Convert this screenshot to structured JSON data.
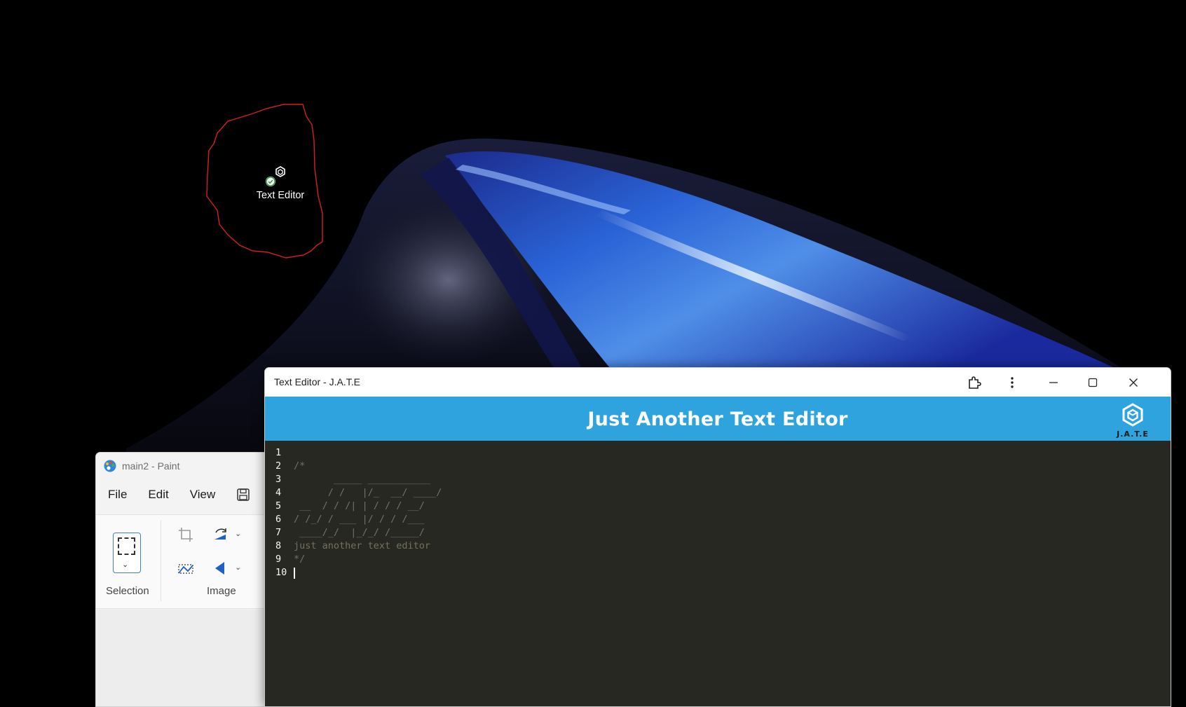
{
  "desktop": {
    "shortcut": {
      "label": "Text Editor",
      "icon": "jate-app-icon",
      "status_icon": "synced-check-icon"
    }
  },
  "paint": {
    "title": "main2 - Paint",
    "app_icon": "paint-palette-icon",
    "menu": {
      "file": "File",
      "edit": "Edit",
      "view": "View"
    },
    "groups": {
      "selection": "Selection",
      "image": "Image"
    },
    "icons": [
      "selection-rectangle-icon",
      "crop-icon",
      "rotate-icon",
      "resize-icon",
      "flip-icon"
    ]
  },
  "editor": {
    "window_title": "Text Editor - J.A.T.E",
    "header_title": "Just Another Text Editor",
    "logo_text": "J.A.T.E",
    "titlebar_icons": [
      "extensions-icon",
      "more-options-icon",
      "minimize-icon",
      "maximize-icon",
      "close-icon"
    ],
    "theme": {
      "header_bg": "#2ea3dd",
      "editor_bg": "#272822",
      "comment_color": "#75715e"
    },
    "lines": [
      {
        "n": "1",
        "text": ""
      },
      {
        "n": "2",
        "text": "/*"
      },
      {
        "n": "3",
        "text": "       _____ ___________"
      },
      {
        "n": "4",
        "text": "      / /   |/_  __/ ____/"
      },
      {
        "n": "5",
        "text": " __  / / /| | / / / __/"
      },
      {
        "n": "6",
        "text": "/ /_/ / ___ |/ / / /___"
      },
      {
        "n": "7",
        "text": " ____/_/  |_/_/ /_____/"
      },
      {
        "n": "8",
        "text": "just another text editor"
      },
      {
        "n": "9",
        "text": "*/"
      },
      {
        "n": "10",
        "text": ""
      }
    ],
    "cursor_line": 10
  }
}
